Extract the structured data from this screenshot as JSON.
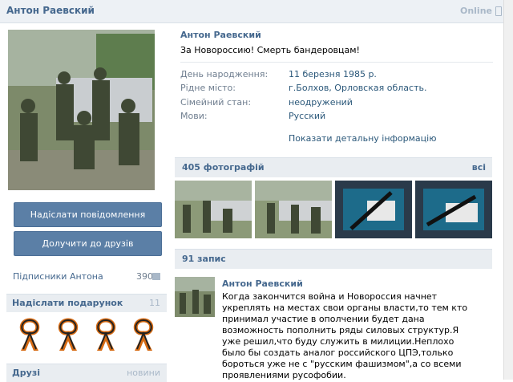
{
  "header": {
    "name": "Антон Раевский",
    "online": "Online"
  },
  "left": {
    "send_message": "Надіслати повідомлення",
    "add_friend": "Долучити до друзів",
    "followers_label": "Підписники Антона",
    "followers_count": "390",
    "gifts_title": "Надіслати подарунок",
    "gifts_count": "11",
    "friends_title": "Друзі",
    "friends_new": "новини"
  },
  "profile": {
    "name": "Антон Раевский",
    "status": "За Новороссию! Смерть бандеровцам!",
    "fields": [
      {
        "label": "День народження:",
        "value": "11 березня 1985 р."
      },
      {
        "label": "Рідне місто:",
        "value": "г.Болхов, Орловская область."
      },
      {
        "label": "Сімейний стан:",
        "value": "неодружений"
      },
      {
        "label": "Мови:",
        "value": "Русский"
      }
    ],
    "show_details": "Показати детальну інформацію"
  },
  "photos": {
    "title": "405 фотографій",
    "all": "всі"
  },
  "wall": {
    "title": "91 запис",
    "post_author": "Антон Раевский",
    "post_text": "Когда закончится война и Новороссия начнет укреплять на местах свои органы власти,то тем кто принимал участие в ополчении будет дана возможность пополнить ряды силовых структур.Я уже решил,что буду служить в милиции.Неплохо было бы создать аналог российского ЦПЭ,только бороться уже не с \"русским фашизмом\",а со всеми проявлениями русофобии."
  },
  "colors": {
    "link": "#45688e",
    "button": "#5b7fa6",
    "header_bg": "#edf1f5"
  }
}
